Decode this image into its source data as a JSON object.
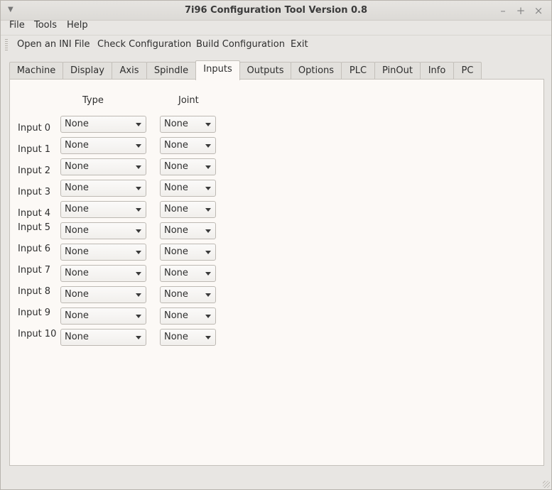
{
  "window": {
    "title": "7i96 Configuration Tool Version 0.8",
    "controls": {
      "minimize": "–",
      "maximize": "+",
      "close": "×"
    }
  },
  "menubar": {
    "items": [
      "File",
      "Tools",
      "Help"
    ]
  },
  "toolbar": {
    "open_label": "Open an INI File",
    "check_label": "Check Configuration",
    "build_label": "Build Configuration",
    "exit_label": "Exit"
  },
  "tabs": [
    "Machine",
    "Display",
    "Axis",
    "Spindle",
    "Inputs",
    "Outputs",
    "Options",
    "PLC",
    "PinOut",
    "Info",
    "PC"
  ],
  "active_tab": "Inputs",
  "inputs": {
    "type_header": "Type",
    "joint_header": "Joint",
    "rows": [
      {
        "label": "Input 0",
        "type": "None",
        "joint": "None"
      },
      {
        "label": "Input 1",
        "type": "None",
        "joint": "None"
      },
      {
        "label": "Input 2",
        "type": "None",
        "joint": "None"
      },
      {
        "label": "Input 3",
        "type": "None",
        "joint": "None"
      },
      {
        "label": "Input 4",
        "type": "None",
        "joint": "None"
      },
      {
        "label": "Input 5",
        "type": "None",
        "joint": "None"
      },
      {
        "label": "Input 6",
        "type": "None",
        "joint": "None"
      },
      {
        "label": "Input 7",
        "type": "None",
        "joint": "None"
      },
      {
        "label": "Input 8",
        "type": "None",
        "joint": "None"
      },
      {
        "label": "Input 9",
        "type": "None",
        "joint": "None"
      },
      {
        "label": "Input 10",
        "type": "None",
        "joint": "None"
      }
    ]
  }
}
